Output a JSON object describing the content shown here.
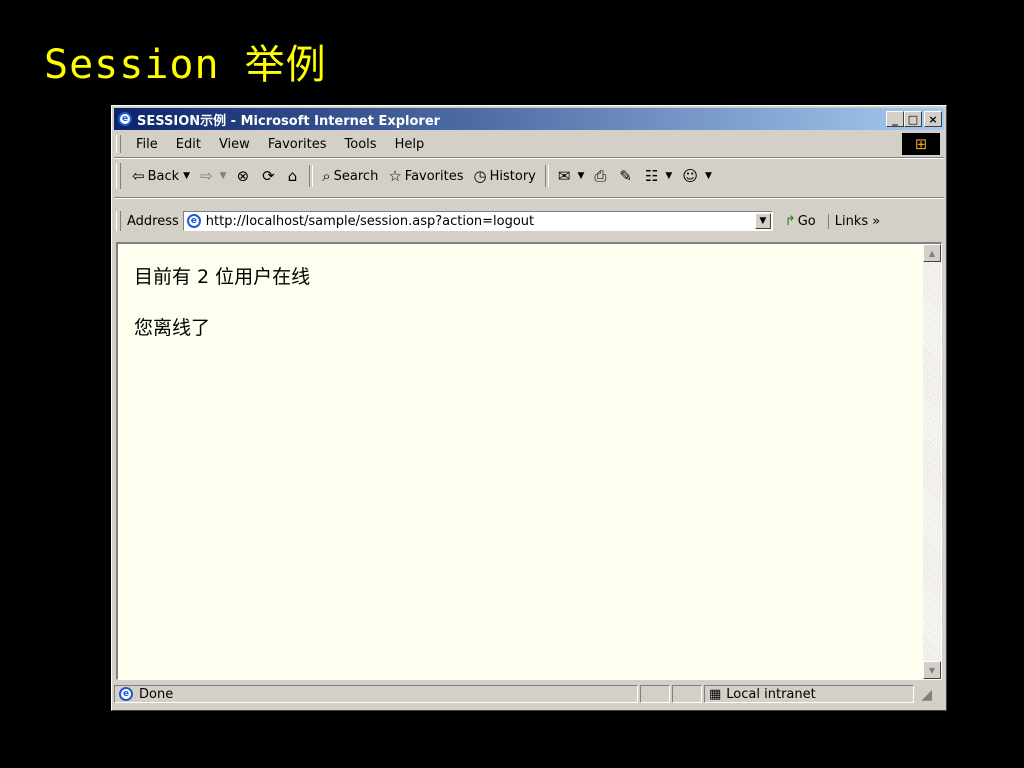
{
  "slide": {
    "title": "Session 举例"
  },
  "window": {
    "title": "SESSION示例 - Microsoft Internet Explorer",
    "controls": {
      "minimize": "_",
      "maximize": "□",
      "close": "×"
    }
  },
  "menu": [
    {
      "label": "File"
    },
    {
      "label": "Edit"
    },
    {
      "label": "View"
    },
    {
      "label": "Favorites"
    },
    {
      "label": "Tools"
    },
    {
      "label": "Help"
    }
  ],
  "toolbar": {
    "back_label": "Back",
    "search_label": "Search",
    "favorites_label": "Favorites",
    "history_label": "History"
  },
  "address": {
    "label": "Address",
    "url": "http://localhost/sample/session.asp?action=logout",
    "go_label": "Go",
    "links_label": "Links »"
  },
  "page": {
    "lines": [
      "目前有 2 位用户在线",
      "您离线了"
    ]
  },
  "status": {
    "text": "Done",
    "zone": "Local intranet"
  },
  "icons": {
    "ie": "ie-logo-icon",
    "back": "back-arrow-icon",
    "forward": "forward-arrow-icon",
    "stop": "stop-icon",
    "refresh": "refresh-icon",
    "home": "home-icon",
    "search": "search-icon",
    "favorites": "favorites-icon",
    "history": "history-icon",
    "mail": "mail-icon",
    "print": "print-icon",
    "edit": "edit-icon",
    "discuss": "discuss-icon",
    "messenger": "messenger-icon",
    "zone": "local-intranet-icon",
    "windows_logo": "windows-logo-icon"
  }
}
